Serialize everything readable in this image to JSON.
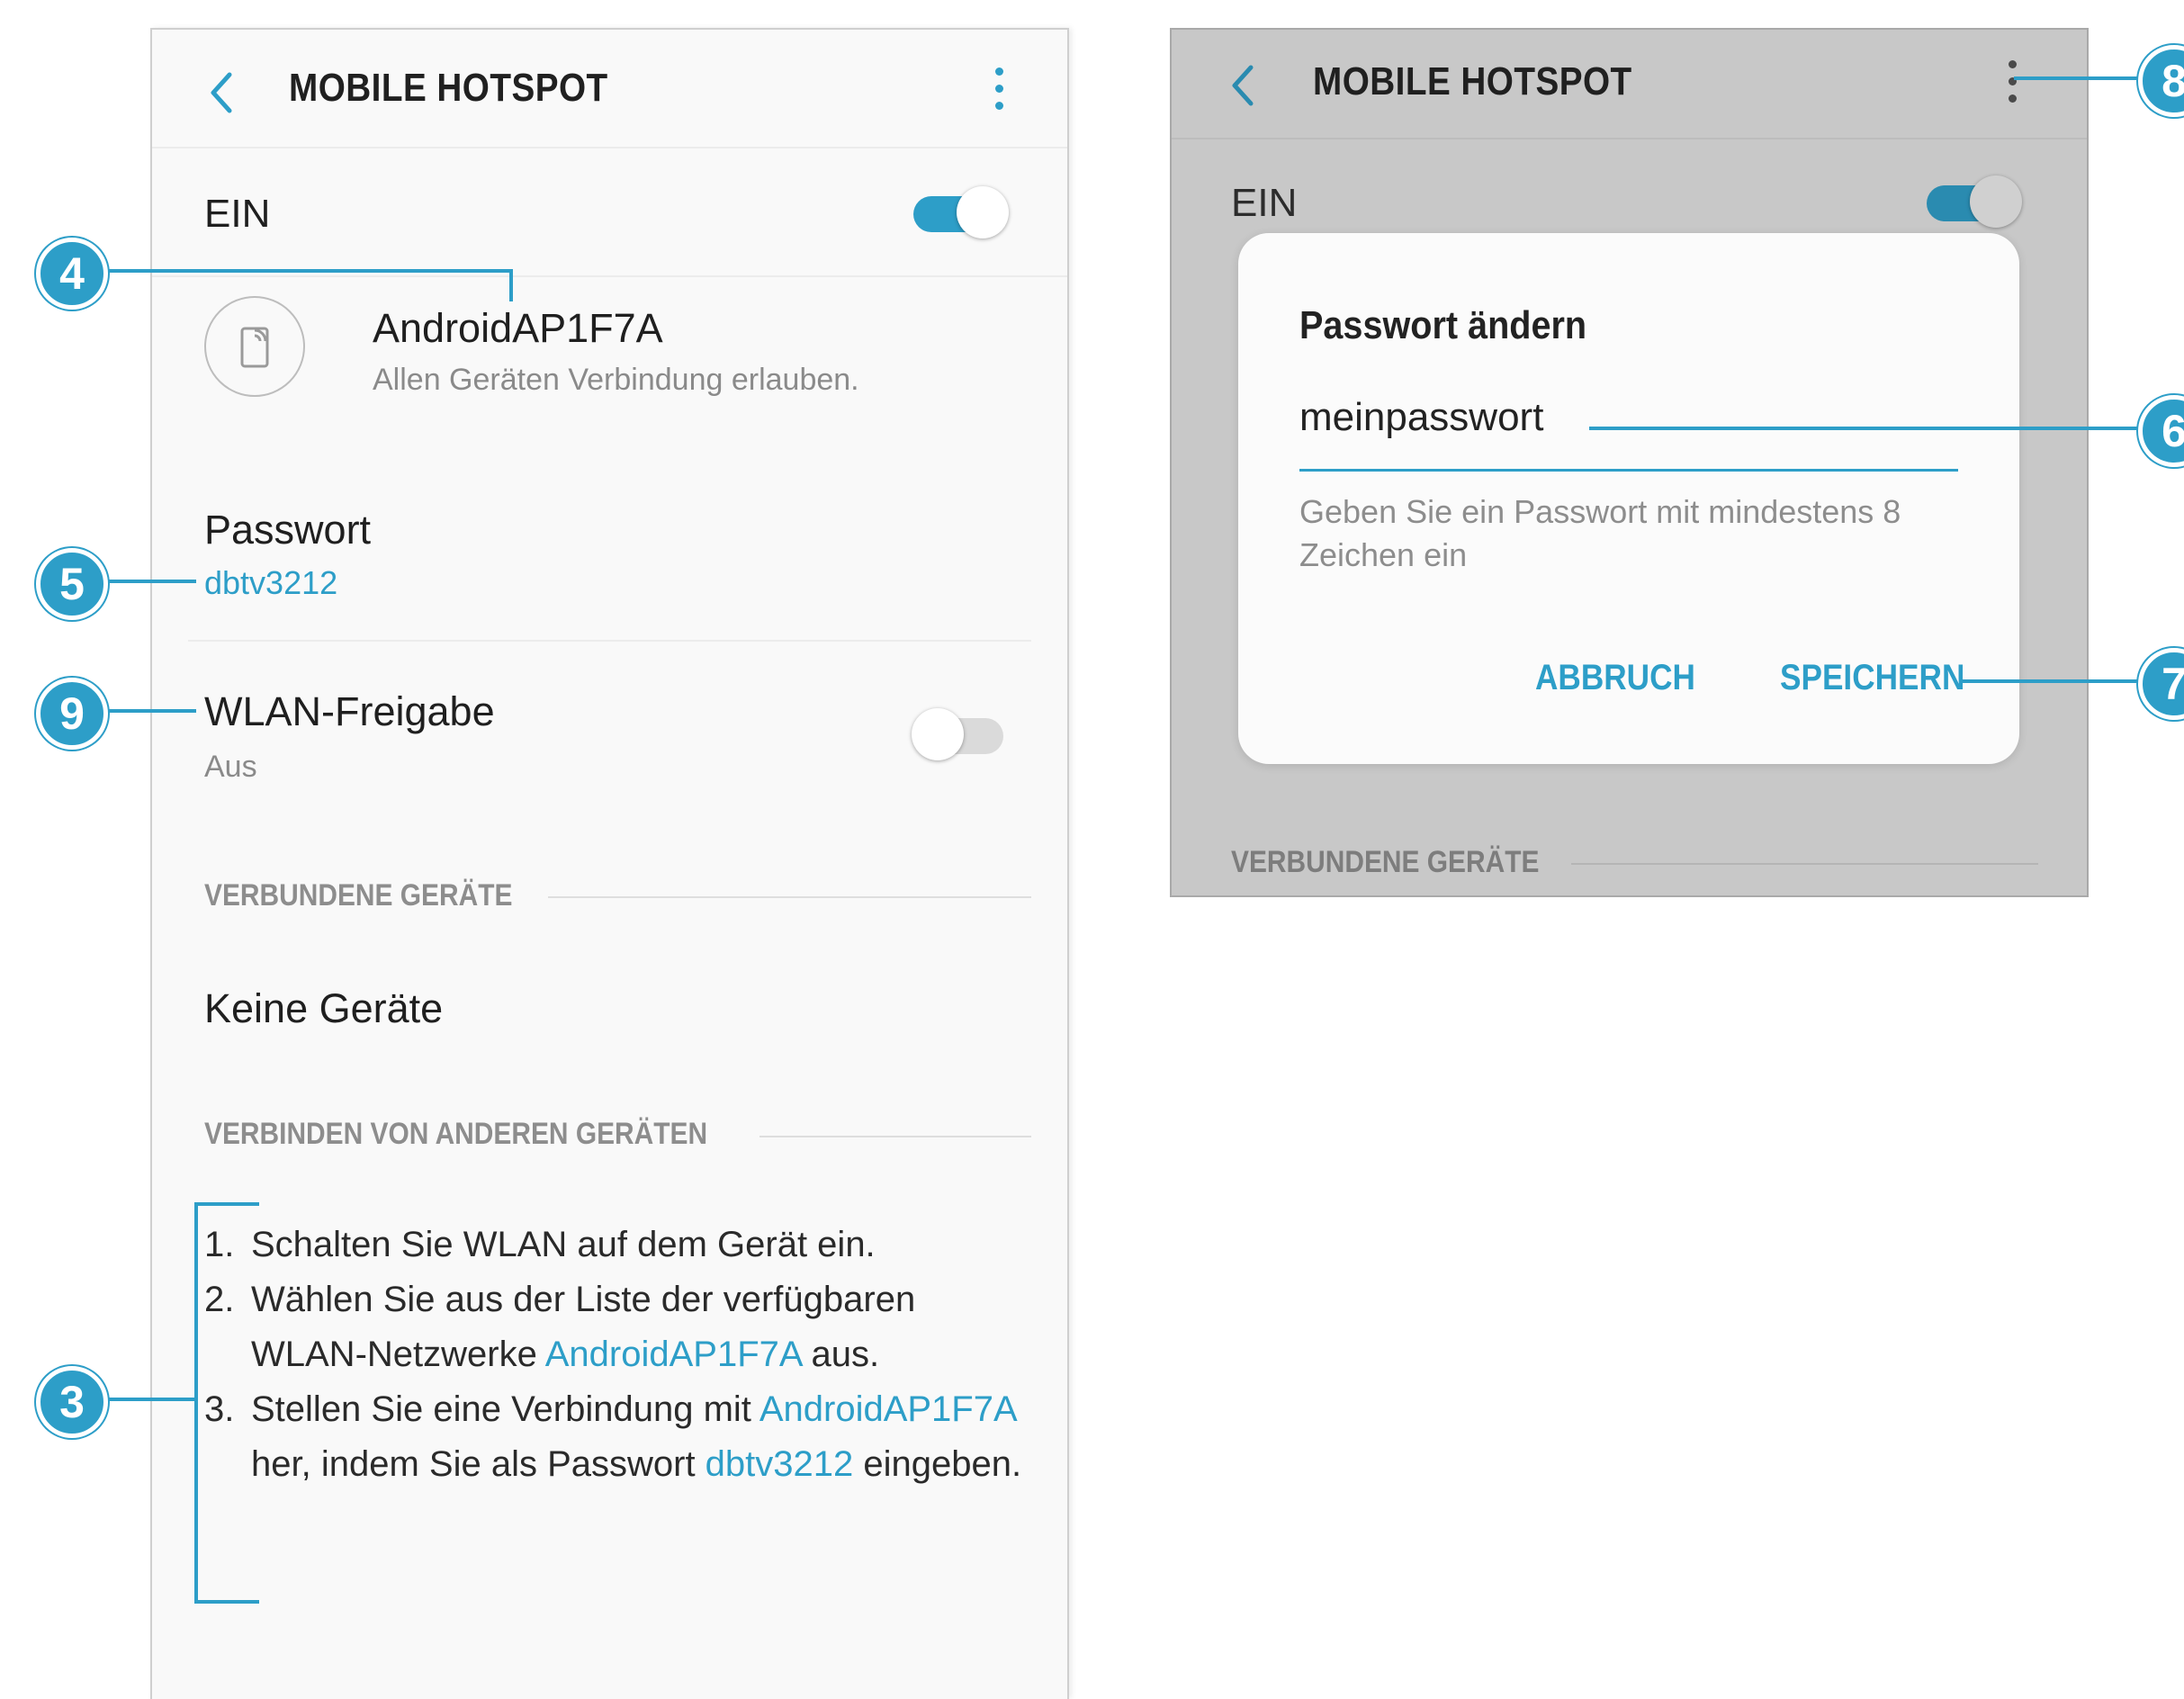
{
  "left_screen": {
    "title": "MOBILE HOTSPOT",
    "master_toggle": {
      "label": "EIN",
      "on": true
    },
    "network": {
      "name": "AndroidAP1F7A",
      "subtitle": "Allen Geräten Verbindung erlauben."
    },
    "password": {
      "label": "Passwort",
      "value": "dbtv3212"
    },
    "wlan_share": {
      "label": "WLAN-Freigabe",
      "status": "Aus",
      "on": false
    },
    "connected_section": "VERBUNDENE GERÄTE",
    "no_devices": "Keine Geräte",
    "connect_section": "VERBINDEN VON ANDEREN GERÄTEN",
    "steps": [
      {
        "num": "1.",
        "text": "Schalten Sie WLAN auf dem Gerät ein."
      },
      {
        "num": "2.",
        "pre": "Wählen Sie aus der Liste der verfügbaren WLAN-Netzwerke ",
        "link": "AndroidAP1F7A",
        "post": " aus."
      },
      {
        "num": "3.",
        "pre": "Stellen Sie eine Verbindung mit ",
        "link": "AndroidAP1F7A",
        "mid": " her, indem Sie als Passwort ",
        "link2": "dbtv3212",
        "post": " eingeben."
      }
    ]
  },
  "right_screen": {
    "title": "MOBILE HOTSPOT",
    "master_toggle": {
      "label": "EIN",
      "on": true
    },
    "connected_section": "VERBUNDENE GERÄTE",
    "dialog": {
      "title": "Passwort ändern",
      "input_value": "meinpasswort",
      "hint": "Geben Sie ein Passwort mit mindestens 8 Zeichen ein",
      "cancel_label": "ABBRUCH",
      "save_label": "SPEICHERN"
    }
  },
  "callouts": {
    "c3": "3",
    "c4": "4",
    "c5": "5",
    "c6": "6",
    "c7": "7",
    "c8": "8",
    "c9": "9"
  },
  "colors": {
    "accent": "#2d9ec8",
    "background": "#f9f9f9",
    "dimmed": "#c8c8c8"
  }
}
